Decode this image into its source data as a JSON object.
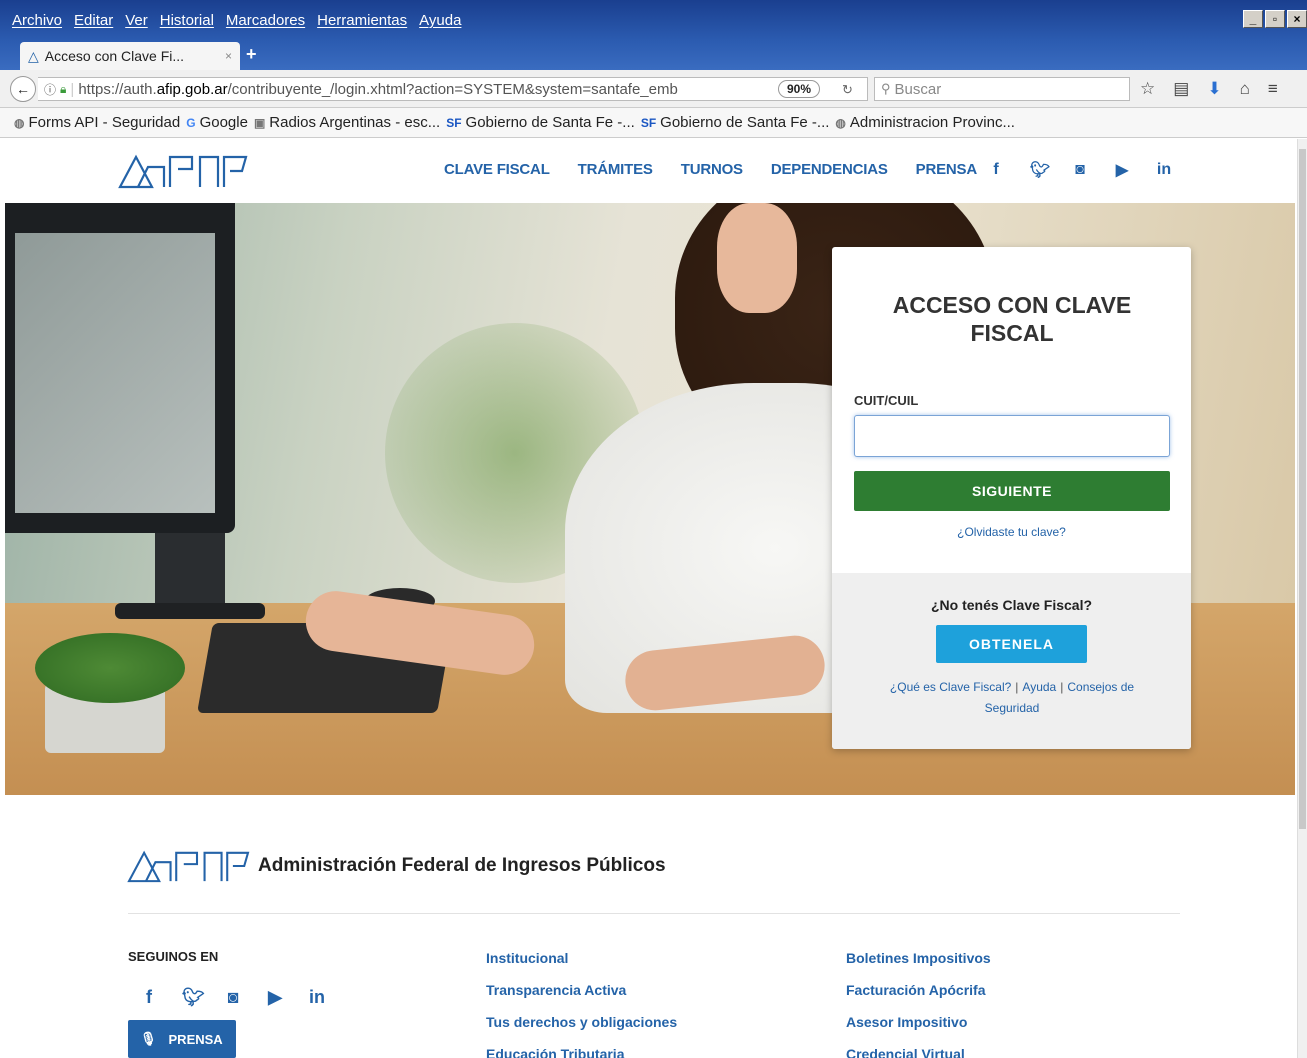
{
  "browser": {
    "menu": [
      "Archivo",
      "Editar",
      "Ver",
      "Historial",
      "Marcadores",
      "Herramientas",
      "Ayuda"
    ],
    "tab_title": "Acceso con Clave Fi...",
    "tab_close": "×",
    "new_tab": "+",
    "url_prefix": "https://auth.",
    "url_host": "afip.gob.ar",
    "url_rest": "/contribuyente_/login.xhtml?action=SYSTEM&system=santafe_emb",
    "zoom": "90%",
    "search_placeholder": "Buscar",
    "bookmarks": [
      {
        "label": "Forms API - Seguridad",
        "icon": "globe-icon"
      },
      {
        "label": "Google",
        "icon": "google-icon"
      },
      {
        "label": "Radios Argentinas - esc...",
        "icon": "radio-icon"
      },
      {
        "label": "Gobierno de Santa Fe -...",
        "icon": "sf-icon"
      },
      {
        "label": "Gobierno de Santa Fe -...",
        "icon": "sf-icon"
      },
      {
        "label": "Administracion Provinc...",
        "icon": "globe-icon"
      }
    ]
  },
  "header": {
    "nav": [
      "CLAVE FISCAL",
      "TRÁMITES",
      "TURNOS",
      "DEPENDENCIAS",
      "PRENSA"
    ],
    "social": [
      "f",
      "t",
      "ig",
      "yt",
      "in"
    ]
  },
  "login": {
    "title": "ACCESO CON CLAVE FISCAL",
    "cuit_label": "CUIT/CUIL",
    "cuit_value": "",
    "next_button": "SIGUIENTE",
    "forgot": "¿Olvidaste tu clave?",
    "no_clave": "¿No tenés Clave Fiscal?",
    "get_button": "OBTENELA",
    "link_what": "¿Qué es Clave Fiscal?",
    "link_help": "Ayuda",
    "link_tips": "Consejos de Seguridad",
    "separator": "|"
  },
  "footer": {
    "org_name": "Administración Federal de Ingresos Públicos",
    "follow": "SEGUINOS EN",
    "prensa": "PRENSA",
    "col1": [
      "Institucional",
      "Transparencia Activa",
      "Tus derechos y obligaciones",
      "Educación Tributaria"
    ],
    "col2": [
      "Boletines Impositivos",
      "Facturación Apócrifa",
      "Asesor Impositivo",
      "Credencial Virtual"
    ]
  },
  "colors": {
    "brand_blue": "#2463a8",
    "primary_green": "#2e7d32",
    "cta_blue": "#1ea1db"
  }
}
